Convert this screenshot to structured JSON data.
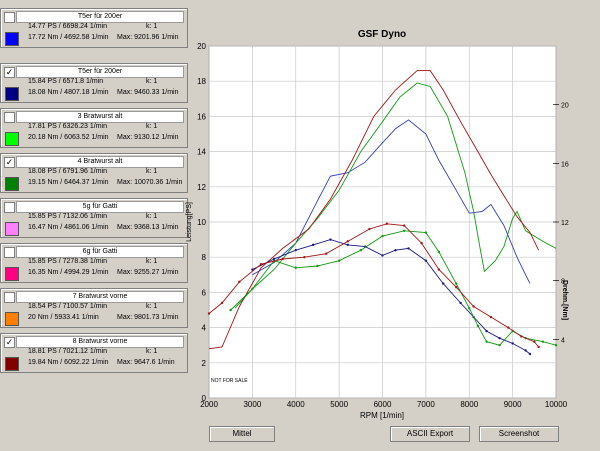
{
  "runs": [
    {
      "name": "T5er für 200er",
      "checked": false,
      "color": "#0000ff",
      "power_line": "14.77 PS / 6698.24 1/min",
      "k_label": "k: 1",
      "torque_line": "17.72 Nm / 4692.58 1/min",
      "max_line": "Max: 9201.96 1/min"
    },
    {
      "name": "T5er für 200er",
      "checked": true,
      "color": "#000080",
      "power_line": "15.84 PS / 6571.8 1/min",
      "k_label": "k: 1",
      "torque_line": "18.08 Nm / 4807.18 1/min",
      "max_line": "Max: 9460.33 1/min"
    },
    {
      "name": "3 Bratwurst alt",
      "checked": false,
      "color": "#00ff00",
      "power_line": "17.81 PS / 6326.23 1/min",
      "k_label": "k: 1",
      "torque_line": "20.18 Nm / 6063.52 1/min",
      "max_line": "Max: 9130.12 1/min"
    },
    {
      "name": "4 Bratwurst alt",
      "checked": true,
      "color": "#008000",
      "power_line": "18.08 PS / 6791.96 1/min",
      "k_label": "k: 1",
      "torque_line": "19.15 Nm / 6464.37 1/min",
      "max_line": "Max: 10070.36 1/min"
    },
    {
      "name": "5g für Gatti",
      "checked": false,
      "color": "#ff80ff",
      "power_line": "15.85 PS / 7132.06 1/min",
      "k_label": "k: 1",
      "torque_line": "16.47 Nm / 4861.06 1/min",
      "max_line": "Max: 9368.13 1/min"
    },
    {
      "name": "6g für Gatti",
      "checked": false,
      "color": "#ff0080",
      "power_line": "15.85 PS / 7278.38 1/min",
      "k_label": "k: 1",
      "torque_line": "16.35 Nm / 4994.29 1/min",
      "max_line": "Max: 9255.27 1/min"
    },
    {
      "name": "7 Bratwurst vorne",
      "checked": false,
      "color": "#ff8000",
      "power_line": "18.54 PS / 7100.57 1/min",
      "k_label": "k: 1",
      "torque_line": "20 Nm / 5933.41 1/min",
      "max_line": "Max: 9801.73 1/min"
    },
    {
      "name": "8 Bratwurst vorne",
      "checked": true,
      "color": "#800000",
      "power_line": "18.81 PS / 7021.12 1/min",
      "k_label": "k: 1",
      "torque_line": "19.84 Nm / 6092.22 1/min",
      "max_line": "Max: 9647.6 1/min"
    }
  ],
  "buttons": {
    "mittel": "Mittel",
    "ascii_export": "ASCII Export",
    "screenshot": "Screenshot"
  },
  "chart_data": {
    "type": "line",
    "title": "GSF Dyno",
    "xlabel": "RPM [1/min]",
    "ylabel": "Leistung[PS]",
    "y2label": "Drehm.[Nm]",
    "xlim": [
      2000,
      10000
    ],
    "ylim": [
      0,
      20
    ],
    "y2_ticks": [
      4,
      8,
      12,
      16,
      20
    ],
    "watermark": "NOT FOR SALE",
    "x_ticks": [
      2000,
      3000,
      4000,
      5000,
      6000,
      7000,
      8000,
      9000,
      10000
    ],
    "y_ticks": [
      0,
      2,
      4,
      6,
      8,
      10,
      12,
      14,
      16,
      18,
      20
    ],
    "grid": true,
    "series": [
      {
        "name": "T5er für 200er",
        "kind": "power",
        "color": "#3040b0",
        "points": [
          [
            3000,
            7
          ],
          [
            3500,
            7.7
          ],
          [
            4000,
            8.8
          ],
          [
            4500,
            11.2
          ],
          [
            4800,
            12.6
          ],
          [
            5200,
            12.8
          ],
          [
            5600,
            13.4
          ],
          [
            6000,
            14.5
          ],
          [
            6300,
            15.3
          ],
          [
            6600,
            15.8
          ],
          [
            7000,
            15
          ],
          [
            7300,
            13.5
          ],
          [
            7700,
            11.8
          ],
          [
            8000,
            10.5
          ],
          [
            8300,
            10.6
          ],
          [
            8500,
            11
          ],
          [
            8800,
            9.8
          ],
          [
            9100,
            8
          ],
          [
            9300,
            7
          ],
          [
            9400,
            6.5
          ]
        ]
      },
      {
        "name": "4 Bratwurst alt",
        "kind": "power",
        "color": "#119911",
        "points": [
          [
            2600,
            5.1
          ],
          [
            3000,
            6.2
          ],
          [
            3500,
            7.3
          ],
          [
            4000,
            8.8
          ],
          [
            4500,
            10.2
          ],
          [
            5000,
            11.8
          ],
          [
            5500,
            14
          ],
          [
            6000,
            15.7
          ],
          [
            6400,
            17.1
          ],
          [
            6800,
            17.9
          ],
          [
            7100,
            17.7
          ],
          [
            7500,
            16
          ],
          [
            7900,
            12.8
          ],
          [
            8100,
            10.6
          ],
          [
            8250,
            8.5
          ],
          [
            8350,
            7.2
          ],
          [
            8600,
            7.8
          ],
          [
            8800,
            8.6
          ],
          [
            9000,
            10.2
          ],
          [
            9100,
            10.6
          ],
          [
            9300,
            9.5
          ],
          [
            9700,
            8.9
          ],
          [
            10000,
            8.5
          ]
        ]
      },
      {
        "name": "8 Bratwurst vorne",
        "kind": "power",
        "color": "#a31515",
        "points": [
          [
            2000,
            2.8
          ],
          [
            2300,
            2.9
          ],
          [
            2700,
            5.2
          ],
          [
            3200,
            7.4
          ],
          [
            3700,
            8.5
          ],
          [
            4300,
            9.6
          ],
          [
            4800,
            11.3
          ],
          [
            5300,
            13.5
          ],
          [
            5800,
            16
          ],
          [
            6300,
            17.5
          ],
          [
            6800,
            18.6
          ],
          [
            7100,
            18.6
          ],
          [
            7400,
            17.5
          ],
          [
            7800,
            15.7
          ],
          [
            8200,
            14
          ],
          [
            8500,
            12.7
          ],
          [
            8800,
            11.5
          ],
          [
            9100,
            10.3
          ],
          [
            9400,
            9.4
          ],
          [
            9600,
            8.4
          ]
        ]
      },
      {
        "name": "T5er für 200er",
        "kind": "torque",
        "color": "#1a1a80",
        "points": [
          [
            3000,
            7.3
          ],
          [
            3500,
            7.9
          ],
          [
            4000,
            8.4
          ],
          [
            4400,
            8.7
          ],
          [
            4800,
            9
          ],
          [
            5200,
            8.7
          ],
          [
            5600,
            8.6
          ],
          [
            6000,
            8.1
          ],
          [
            6300,
            8.4
          ],
          [
            6600,
            8.5
          ],
          [
            7000,
            7.8
          ],
          [
            7400,
            6.5
          ],
          [
            7800,
            5.4
          ],
          [
            8100,
            4.6
          ],
          [
            8400,
            3.8
          ],
          [
            8700,
            3.4
          ],
          [
            9000,
            3.1
          ],
          [
            9300,
            2.7
          ],
          [
            9400,
            2.5
          ]
        ]
      },
      {
        "name": "4 Bratwurst alt",
        "kind": "torque",
        "color": "#119911",
        "points": [
          [
            2500,
            5
          ],
          [
            3000,
            6.2
          ],
          [
            3500,
            7.8
          ],
          [
            4000,
            7.4
          ],
          [
            4500,
            7.5
          ],
          [
            5000,
            7.8
          ],
          [
            5500,
            8.4
          ],
          [
            6000,
            9.2
          ],
          [
            6500,
            9.5
          ],
          [
            7000,
            9.4
          ],
          [
            7300,
            8.3
          ],
          [
            7700,
            6.5
          ],
          [
            8000,
            5.1
          ],
          [
            8200,
            4.1
          ],
          [
            8400,
            3.2
          ],
          [
            8700,
            3
          ],
          [
            9000,
            3.8
          ],
          [
            9300,
            3.4
          ],
          [
            9700,
            3.2
          ],
          [
            10000,
            3
          ]
        ]
      },
      {
        "name": "8 Bratwurst vorne",
        "kind": "torque",
        "color": "#a31515",
        "points": [
          [
            2000,
            4.8
          ],
          [
            2300,
            5.4
          ],
          [
            2700,
            6.6
          ],
          [
            3200,
            7.6
          ],
          [
            3700,
            7.9
          ],
          [
            4200,
            8
          ],
          [
            4700,
            8.2
          ],
          [
            5200,
            8.9
          ],
          [
            5700,
            9.6
          ],
          [
            6100,
            9.9
          ],
          [
            6500,
            9.8
          ],
          [
            6900,
            8.8
          ],
          [
            7300,
            7.3
          ],
          [
            7700,
            6.3
          ],
          [
            8100,
            5.2
          ],
          [
            8500,
            4.6
          ],
          [
            8900,
            4
          ],
          [
            9200,
            3.5
          ],
          [
            9500,
            3.2
          ],
          [
            9600,
            2.9
          ]
        ]
      }
    ]
  }
}
